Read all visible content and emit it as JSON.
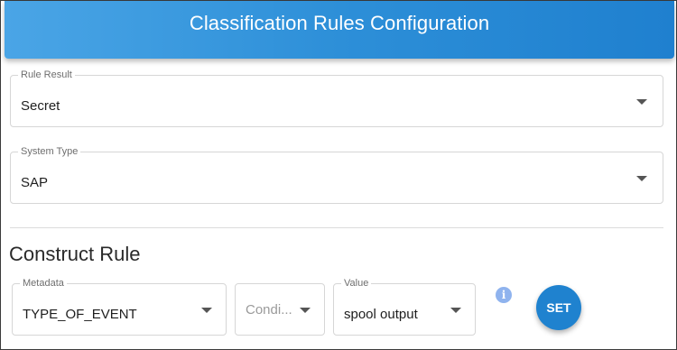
{
  "header": {
    "title": "Classification Rules Configuration"
  },
  "rule_result": {
    "label": "Rule Result",
    "value": "Secret"
  },
  "system_type": {
    "label": "System Type",
    "value": "SAP"
  },
  "construct_rule": {
    "title": "Construct Rule",
    "metadata": {
      "label": "Metadata",
      "value": "TYPE_OF_EVENT"
    },
    "condition": {
      "placeholder": "Condi..."
    },
    "value": {
      "label": "Value",
      "value": "spool output"
    },
    "info_icon": {
      "name": "info-icon",
      "glyph": "i"
    },
    "set_button": {
      "label": "SET"
    }
  },
  "colors": {
    "header_start": "#4aa5e6",
    "header_end": "#1f80cf",
    "button": "#1f82cf",
    "info_icon": "#8fb3ee"
  }
}
